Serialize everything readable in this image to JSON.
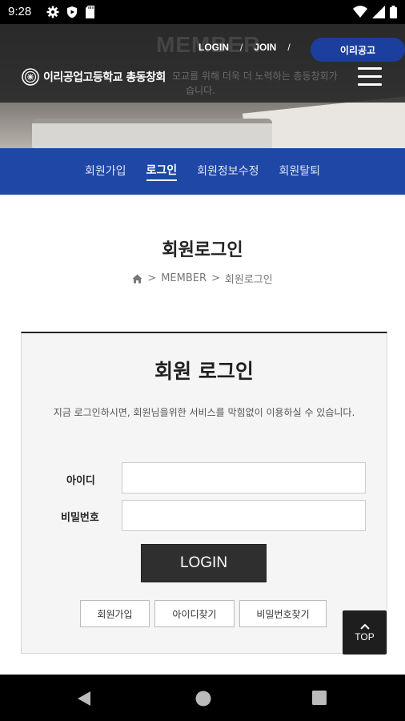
{
  "status_bar": {
    "time": "9:28"
  },
  "hero": {
    "big_word": "MEMBER",
    "tagline": "모교를 위해 더욱 더 노력하는 총동창회가",
    "tagline2": "습니다."
  },
  "top_nav": {
    "login": "LOGIN",
    "join": "JOIN",
    "separator": "/",
    "school_button": "이리공고"
  },
  "logo": {
    "text": "이리공업고등학교 총동창회"
  },
  "sub_nav": {
    "items": [
      {
        "label": "회원가입",
        "active": false
      },
      {
        "label": "로그인",
        "active": true
      },
      {
        "label": "회원정보수정",
        "active": false
      },
      {
        "label": "회원탈퇴",
        "active": false
      }
    ]
  },
  "page": {
    "title": "회원로그인",
    "breadcrumb": {
      "home_icon": "home-icon",
      "level1": "MEMBER",
      "level2": "회원로그인",
      "separator": ">"
    }
  },
  "login_form": {
    "heading": "회원 로그인",
    "description": "지금 로그인하시면, 회원님을위한 서비스를 막힘없이 이용하실 수 있습니다.",
    "id_label": "아이디",
    "id_value": "",
    "password_label": "비밀번호",
    "password_value": "",
    "login_button": "LOGIN",
    "join_button": "회원가입",
    "find_id_button": "아이디찾기",
    "find_password_button": "비밀번호찾기"
  },
  "top_button": {
    "label": "TOP"
  },
  "colors": {
    "brand_blue": "#1f47a6",
    "dark": "#2f2f2f"
  }
}
